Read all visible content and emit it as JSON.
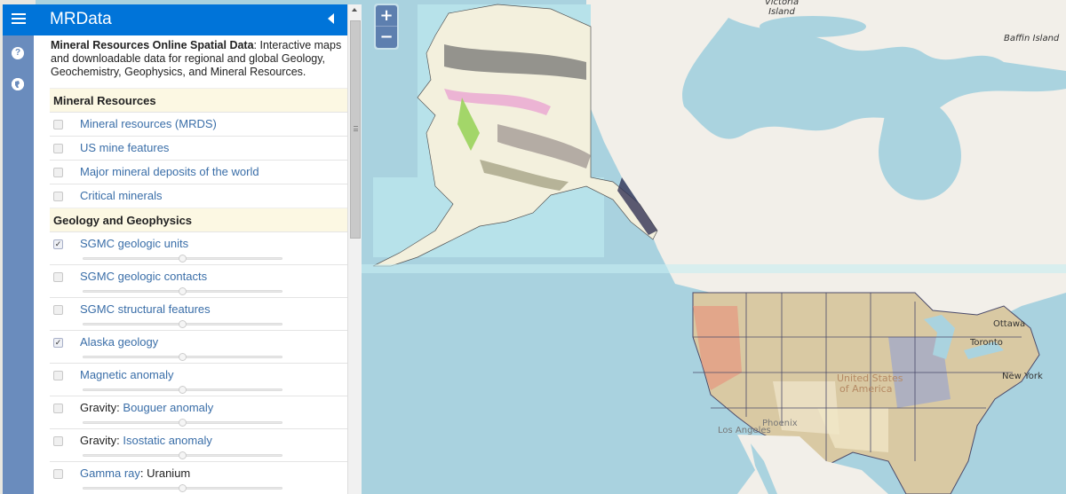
{
  "app": {
    "title": "MRData",
    "intro_bold": "Mineral Resources Online Spatial Data",
    "intro_rest": ": Interactive maps and downloadable data for regional and global Geology, Geochemistry, Geophysics, and Mineral Resources.",
    "header_color": "#0074d9"
  },
  "tabs": [
    {
      "icon": "question-icon",
      "glyph": "?"
    },
    {
      "icon": "globe-icon",
      "glyph": "●"
    }
  ],
  "sections": [
    {
      "title": "Mineral Resources",
      "items": [
        {
          "label": "Mineral resources (MRDS)",
          "checked": false
        },
        {
          "label": "US mine features",
          "checked": false
        },
        {
          "label": "Major mineral deposits of the world",
          "checked": false
        },
        {
          "label": "Critical minerals",
          "checked": false
        }
      ]
    },
    {
      "title": "Geology and Geophysics",
      "items": [
        {
          "label": "SGMC geologic units",
          "checked": true,
          "opacity": 0.5
        },
        {
          "label": "SGMC geologic contacts",
          "checked": false,
          "opacity": 0.5
        },
        {
          "label": "SGMC structural features",
          "checked": false,
          "opacity": 0.5
        },
        {
          "label": "Alaska geology",
          "checked": true,
          "opacity": 0.5
        },
        {
          "label": "Magnetic anomaly",
          "checked": false,
          "opacity": 0.5
        },
        {
          "prefix": "Gravity: ",
          "label": "Bouguer anomaly",
          "checked": false,
          "opacity": 0.5
        },
        {
          "prefix": "Gravity: ",
          "label": "Isostatic anomaly",
          "checked": false,
          "opacity": 0.5
        },
        {
          "label": "Gamma ray",
          "suffix": ": Uranium",
          "checked": false,
          "opacity": 0.5
        }
      ]
    }
  ],
  "map": {
    "zoom_in": "+",
    "zoom_out": "−",
    "labels": {
      "victoria": "Victoria Island",
      "baffin": "Baffin Island",
      "ottawa": "Ottawa",
      "toronto": "Toronto",
      "newyork": "New York",
      "usa1": "United States",
      "usa2": "of America",
      "la": "Los Angeles",
      "phoenix": "Phoenix"
    }
  }
}
